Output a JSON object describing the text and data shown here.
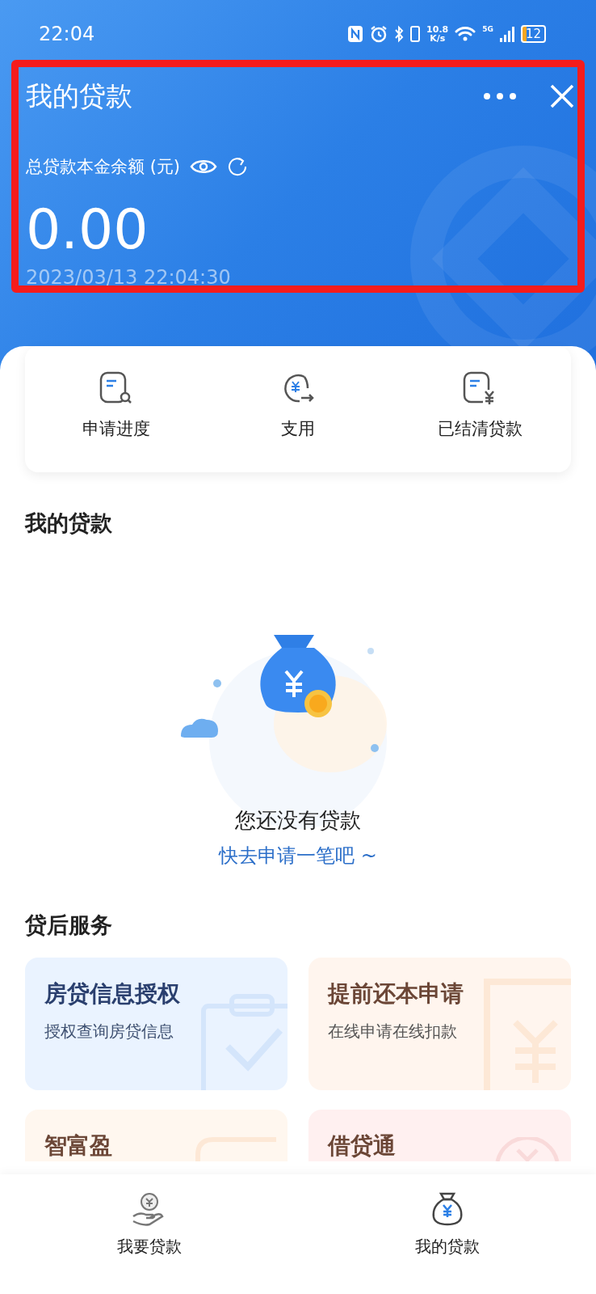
{
  "status_bar": {
    "time": "22:04",
    "net_speed": [
      "10.8",
      "K/s"
    ],
    "network": "5G",
    "battery": "12"
  },
  "header": {
    "title": "我的贷款",
    "balance_label": "总贷款本金余额 (元)",
    "balance": "0.00",
    "updated": "2023/03/13 22:04:30"
  },
  "quick_actions": [
    {
      "label": "申请进度",
      "kind": "progress"
    },
    {
      "label": "支用",
      "kind": "draw"
    },
    {
      "label": "已结清贷款",
      "kind": "settled"
    }
  ],
  "my_loans": {
    "title": "我的贷款",
    "empty_text": "您还没有贷款",
    "empty_link": "快去申请一笔吧 ~"
  },
  "services": {
    "title": "贷后服务",
    "cards": [
      {
        "title": "房贷信息授权",
        "subtitle": "授权查询房贷信息",
        "kind": "blue"
      },
      {
        "title": "提前还本申请",
        "subtitle": "在线申请在线扣款",
        "kind": "orange"
      },
      {
        "title": "智富盈",
        "kind": "peach"
      },
      {
        "title": "借贷通",
        "kind": "pink"
      }
    ]
  },
  "bottom_nav": [
    {
      "label": "我要贷款",
      "kind": "apply"
    },
    {
      "label": "我的贷款",
      "kind": "mine"
    }
  ]
}
